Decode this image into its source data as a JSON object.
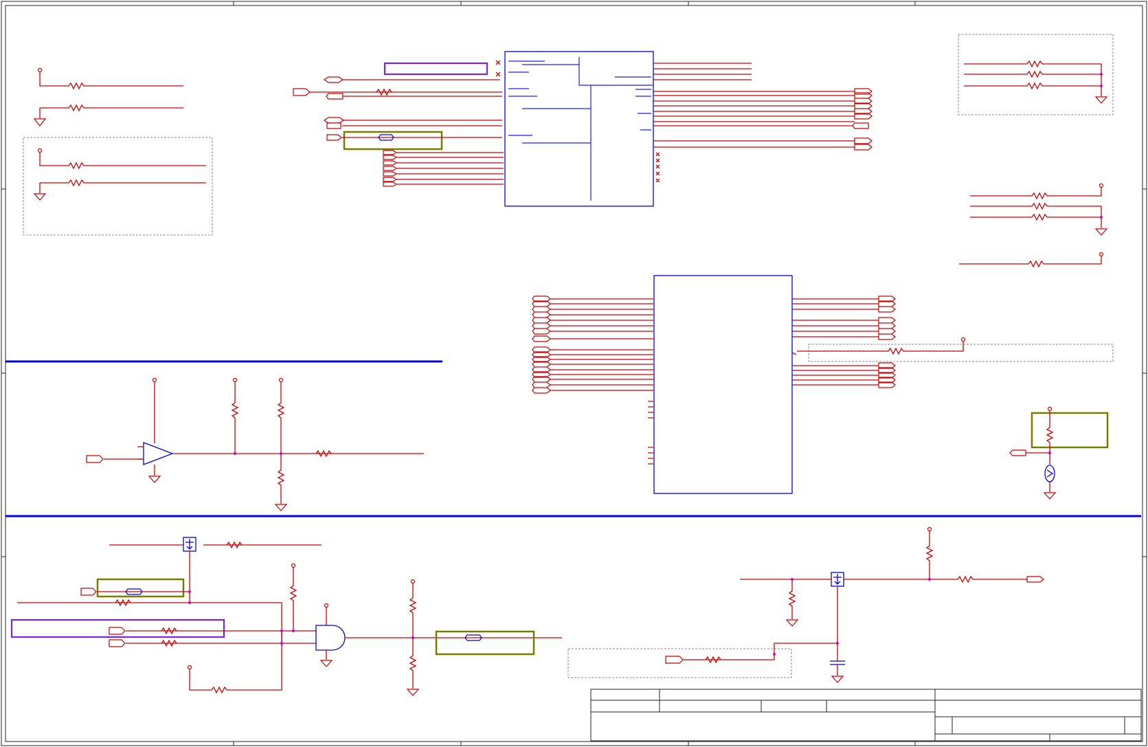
{
  "page": {
    "title": "",
    "colors": {
      "wire": "#cc0000",
      "component": "#0000dd",
      "section_divider": "#0000ee",
      "highlight_olive": "#7a7a00",
      "highlight_purple": "#7a22dd",
      "junction": "#cc00cc"
    }
  },
  "title_block": {
    "title": "",
    "size": "",
    "document_number": "",
    "revision": "",
    "date": "",
    "sheet": ""
  }
}
